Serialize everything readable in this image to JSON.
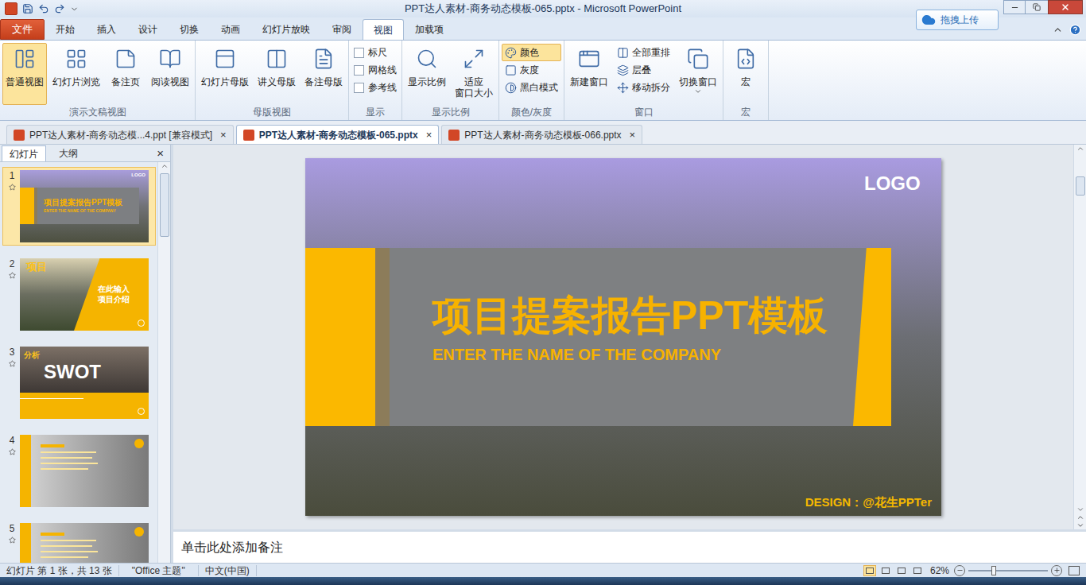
{
  "window": {
    "title": "PPT达人素材-商务动态模板-065.pptx - Microsoft PowerPoint",
    "upload_button": "拖拽上传"
  },
  "ribbon_tabs": [
    {
      "label": "文件",
      "kind": "file",
      "selected": false
    },
    {
      "label": "开始",
      "kind": "tab",
      "selected": false
    },
    {
      "label": "插入",
      "kind": "tab",
      "selected": false
    },
    {
      "label": "设计",
      "kind": "tab",
      "selected": false
    },
    {
      "label": "切换",
      "kind": "tab",
      "selected": false
    },
    {
      "label": "动画",
      "kind": "tab",
      "selected": false
    },
    {
      "label": "幻灯片放映",
      "kind": "tab",
      "selected": false
    },
    {
      "label": "审阅",
      "kind": "tab",
      "selected": false
    },
    {
      "label": "视图",
      "kind": "tab",
      "selected": true
    },
    {
      "label": "加载项",
      "kind": "tab",
      "selected": false
    }
  ],
  "ribbon_groups": [
    {
      "label": "演示文稿视图",
      "items": [
        {
          "label": "普通视图",
          "kind": "large",
          "selected": true
        },
        {
          "label": "幻灯片浏览",
          "kind": "large",
          "selected": false
        },
        {
          "label": "备注页",
          "kind": "large",
          "selected": false
        },
        {
          "label": "阅读视图",
          "kind": "large",
          "selected": false
        }
      ]
    },
    {
      "label": "母版视图",
      "items": [
        {
          "label": "幻灯片母版",
          "kind": "large",
          "selected": false
        },
        {
          "label": "讲义母版",
          "kind": "large",
          "selected": false
        },
        {
          "label": "备注母版",
          "kind": "large",
          "selected": false
        }
      ]
    },
    {
      "label": "显示",
      "items": [
        {
          "label": "标尺",
          "kind": "checkbox",
          "checked": false
        },
        {
          "label": "网格线",
          "kind": "checkbox",
          "checked": false
        },
        {
          "label": "参考线",
          "kind": "checkbox",
          "checked": false
        }
      ]
    },
    {
      "label": "显示比例",
      "items": [
        {
          "label": "显示比例",
          "kind": "large",
          "selected": false
        },
        {
          "label": "适应",
          "label_line2": "窗口大小",
          "kind": "large",
          "selected": false
        }
      ]
    },
    {
      "label": "颜色/灰度",
      "items": [
        {
          "label": "颜色",
          "kind": "small",
          "selected": true
        },
        {
          "label": "灰度",
          "kind": "small",
          "selected": false
        },
        {
          "label": "黑白模式",
          "kind": "small",
          "selected": false
        }
      ]
    },
    {
      "label": "窗口",
      "items": [
        {
          "label": "新建窗口",
          "kind": "large",
          "selected": false
        },
        {
          "label": "全部重排",
          "kind": "small",
          "selected": false
        },
        {
          "label": "层叠",
          "kind": "small",
          "selected": false
        },
        {
          "label": "移动拆分",
          "kind": "small",
          "selected": false
        },
        {
          "label": "切换窗口",
          "kind": "large",
          "selected": false,
          "dropdown": true
        }
      ]
    },
    {
      "label": "宏",
      "items": [
        {
          "label": "宏",
          "kind": "large",
          "selected": false
        }
      ]
    }
  ],
  "doc_tabs": [
    {
      "label": "PPT达人素材-商务动态模...4.ppt [兼容模式]",
      "selected": false,
      "close": "×"
    },
    {
      "label": "PPT达人素材-商务动态模板-065.pptx",
      "selected": true,
      "close": "×"
    },
    {
      "label": "PPT达人素材-商务动态模板-066.pptx",
      "selected": false,
      "close": "×"
    }
  ],
  "panel": {
    "tabs": [
      {
        "label": "幻灯片",
        "selected": true
      },
      {
        "label": "大纲",
        "selected": false
      }
    ],
    "close": "×"
  },
  "thumbnails": [
    {
      "number": "1",
      "selected": true,
      "kind": "title",
      "logo": "LOGO",
      "title": "项目提案报告PPT模板",
      "subtitle": "ENTER THE NAME OF THE COMPANY"
    },
    {
      "number": "2",
      "selected": false,
      "kind": "intro",
      "heading": "项目",
      "lines": [
        "在此输入",
        "项目介绍"
      ]
    },
    {
      "number": "3",
      "selected": false,
      "kind": "swot",
      "heading": "分析",
      "title": "SWOT"
    },
    {
      "number": "4",
      "selected": false,
      "kind": "list"
    },
    {
      "number": "5",
      "selected": false,
      "kind": "list"
    }
  ],
  "slide": {
    "logo": "LOGO",
    "title": "项目提案报告PPT模板",
    "subtitle": "ENTER THE NAME OF THE COMPANY",
    "credit": "DESIGN：@花生PPTer"
  },
  "notes": {
    "placeholder": "单击此处添加备注"
  },
  "status_bar": {
    "slide_info": "幻灯片 第 1 张，共 13 张",
    "theme": "\"Office 主题\"",
    "language": "中文(中国)",
    "views": [
      {
        "selected": true
      },
      {
        "selected": false
      },
      {
        "selected": false
      },
      {
        "selected": false
      }
    ],
    "zoom": "62%",
    "zoom_level": 0.29
  }
}
